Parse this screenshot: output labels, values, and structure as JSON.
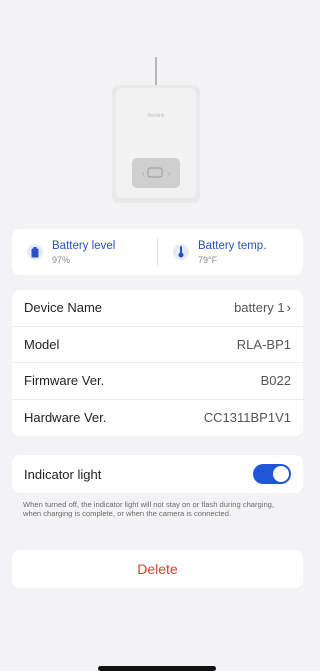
{
  "device": {
    "brand": "Reolink"
  },
  "battery": {
    "level_label": "Battery level",
    "level_value": "97%",
    "temp_label": "Battery temp.",
    "temp_value": "79°F"
  },
  "info": [
    {
      "key": "Device Name",
      "value": "battery 1"
    },
    {
      "key": "Model",
      "value": "RLA-BP1"
    },
    {
      "key": "Firmware Ver.",
      "value": "B022"
    },
    {
      "key": "Hardware Ver.",
      "value": "CC1311BP1V1"
    }
  ],
  "indicator": {
    "label": "Indicator light",
    "enabled": true,
    "note": "When turned off, the indicator light will not stay on or flash during charging, when charging is complete, or when the camera is connected."
  },
  "delete_label": "Delete",
  "colors": {
    "accent": "#1f56d8",
    "danger": "#d9402e"
  }
}
